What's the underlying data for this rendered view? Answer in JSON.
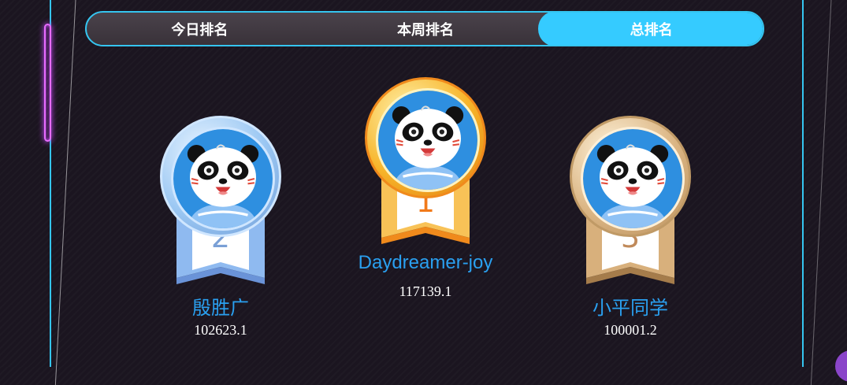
{
  "tabs": [
    {
      "label": "今日排名",
      "active": false
    },
    {
      "label": "本周排名",
      "active": false
    },
    {
      "label": "总排名",
      "active": true
    }
  ],
  "podium": [
    {
      "rank": "2",
      "name": "殷胜广",
      "score": "102623.1",
      "tier": "silver"
    },
    {
      "rank": "1",
      "name": "Daydreamer-joy",
      "score": "117139.1",
      "tier": "gold"
    },
    {
      "rank": "3",
      "name": "小平同学",
      "score": "100001.2",
      "tier": "bronze"
    }
  ],
  "colors": {
    "accent": "#35cbff",
    "name_text": "#2aa0f0",
    "gold": "#f7a51a",
    "silver": "#8fc0f0",
    "bronze": "#d9b07c"
  }
}
